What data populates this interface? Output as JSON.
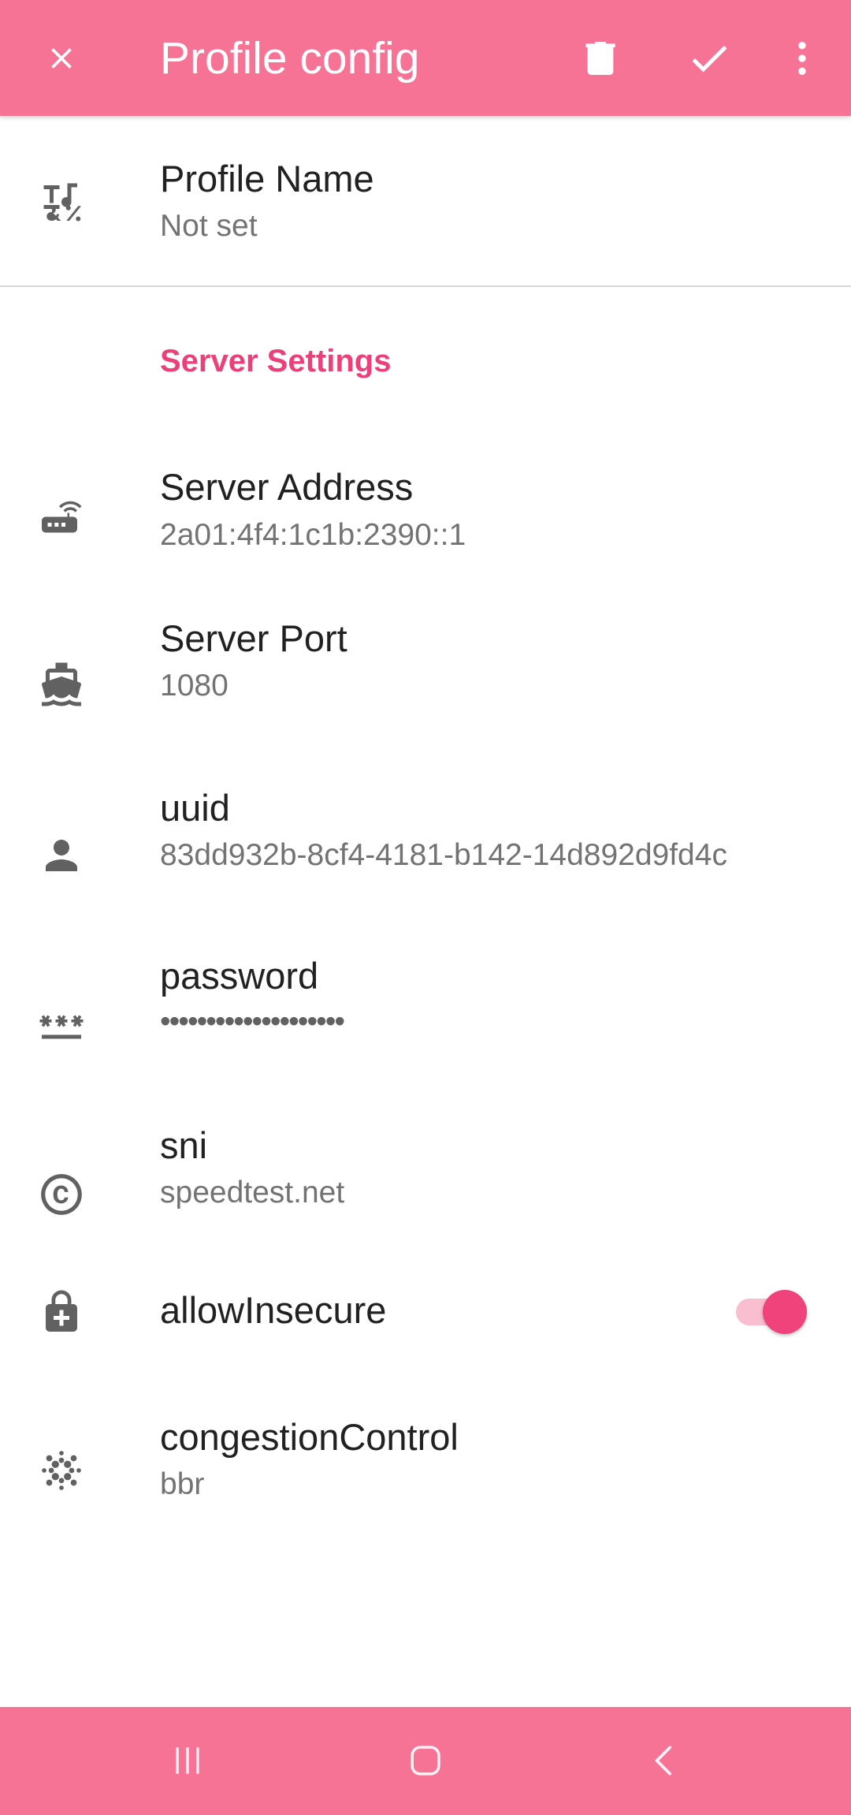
{
  "appbar": {
    "title": "Profile config",
    "icons": {
      "close": "close-icon",
      "delete": "delete-icon",
      "confirm": "check-icon",
      "more": "more-vert-icon"
    }
  },
  "profile": {
    "name_title": "Profile Name",
    "name_summary": "Not set",
    "icon": "text-format-icon"
  },
  "server_settings": {
    "category_label": "Server Settings",
    "items": [
      {
        "title": "Server Address",
        "summary": "2a01:4f4:1c1b:2390::1",
        "icon": "router-icon"
      },
      {
        "title": "Server Port",
        "summary": "1080",
        "icon": "ferry-icon"
      },
      {
        "title": "uuid",
        "summary": "83dd932b-8cf4-4181-b142-14d892d9fd4c",
        "icon": "person-icon"
      },
      {
        "title": "password",
        "summary": "••••••••••••••••••••",
        "icon": "password-icon"
      },
      {
        "title": "sni",
        "summary": "speedtest.net",
        "icon": "copyright-icon"
      },
      {
        "title": "allowInsecure",
        "summary": "",
        "icon": "enhanced-encryption-icon",
        "switch_on": true
      },
      {
        "title": "congestionControl",
        "summary": "bbr",
        "icon": "blur-on-icon"
      }
    ]
  },
  "navbar": {
    "icons": [
      "recents-icon",
      "home-icon",
      "back-icon"
    ]
  },
  "colors": {
    "appbar": "#f77396",
    "navbar": "#f77396",
    "accent": "#ec407a",
    "switch_thumb": "#f1437b",
    "switch_track": "#f9bed0",
    "title_text": "#212121",
    "summary_text": "#737373",
    "icon": "#616161"
  }
}
